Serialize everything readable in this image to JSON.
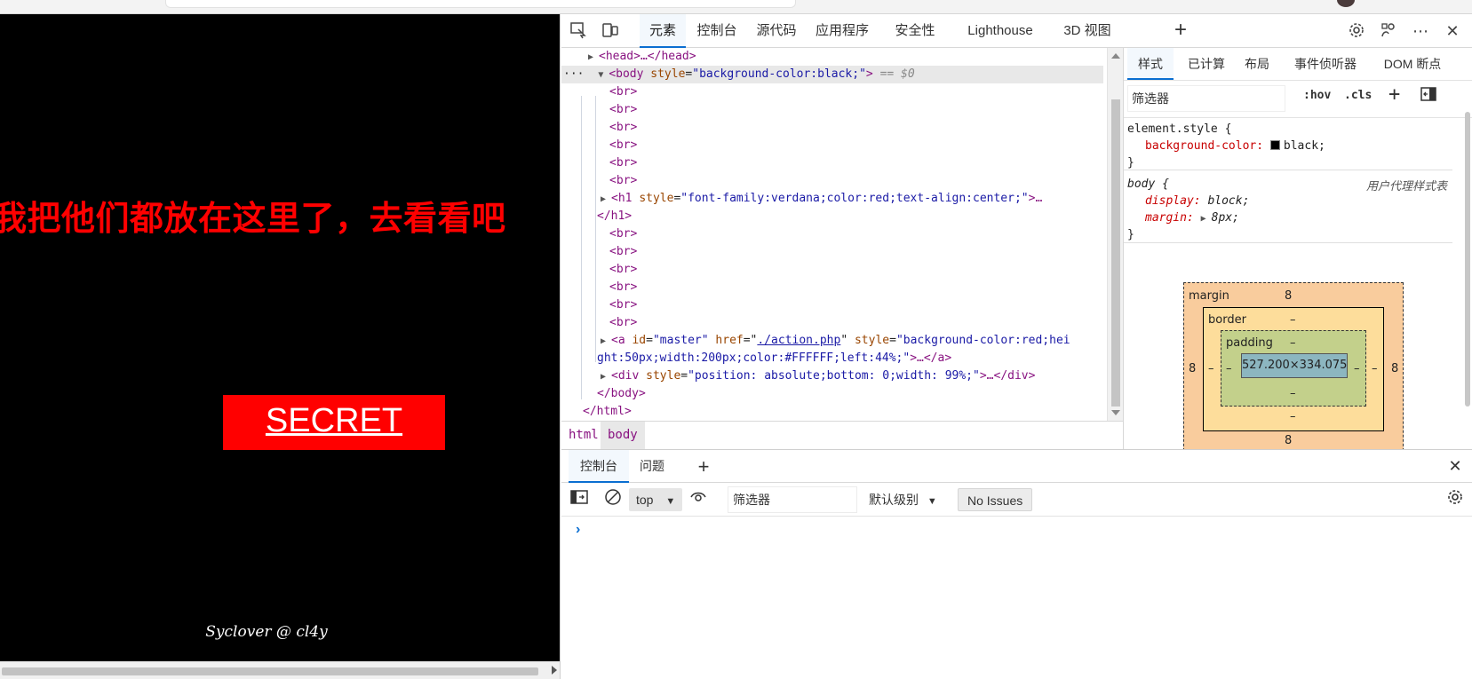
{
  "page": {
    "heading": "我把他们都放在这里了，去看看吧",
    "secret_link": "SECRET",
    "footer": "Syclover @ cl4y"
  },
  "devtools": {
    "tabs": [
      "元素",
      "控制台",
      "源代码",
      "应用程序",
      "安全性",
      "Lighthouse",
      "3D 视图"
    ],
    "elements": {
      "head": "<head>…</head>",
      "body_open_tag": "<body ",
      "body_attr": "style",
      "body_val": "\"background-color:black;\"",
      "body_close": ">",
      "body_ref": "== $0",
      "br": "<br>",
      "h1_tag": "<h1 ",
      "h1_attr": "style",
      "h1_val": "\"font-family:verdana;color:red;text-align:center;\"",
      "h1_end": ">…",
      "h1_close": "</h1>",
      "a_tag": "<a ",
      "a_attr_id": "id",
      "a_val_id": "\"master\"",
      "a_attr_href": "href",
      "a_val_href": "./action.php",
      "a_attr_style": "style",
      "a_val_style_1": "\"background-color:red;hei",
      "a_val_style_2": "ght:50px;width:200px;color:#FFFFFF;left:44%;\"",
      "a_end": ">…</a>",
      "div_tag": "<div ",
      "div_attr": "style",
      "div_val": "\"position: absolute;bottom: 0;width: 99%;\"",
      "div_end": ">…</div>",
      "body_end": "</body>",
      "html_end": "</html>"
    },
    "breadcrumb": [
      "html",
      "body"
    ],
    "styles": {
      "tabs": [
        "样式",
        "已计算",
        "布局",
        "事件侦听器",
        "DOM 断点"
      ],
      "filter_placeholder": "筛选器",
      "hov": ":hov",
      "cls": ".cls",
      "element_style_selector": "element.style {",
      "element_style_prop": "background-color:",
      "element_style_value": "black;",
      "close_brace": "}",
      "body_selector": "body {",
      "ua_label": "用户代理样式表",
      "display_prop": "display:",
      "display_value": "block;",
      "margin_prop": "margin:",
      "margin_value": "8px;"
    },
    "box_model": {
      "margin_label": "margin",
      "margin": "8",
      "border_label": "border",
      "border": "–",
      "padding_label": "padding",
      "padding": "–",
      "content": "527.200×334.075",
      "side_value": "8",
      "dash": "–"
    },
    "drawer": {
      "tabs": [
        "控制台",
        "问题"
      ],
      "context": "top",
      "filter_placeholder": "筛选器",
      "level": "默认级别",
      "issues": "No Issues"
    }
  }
}
